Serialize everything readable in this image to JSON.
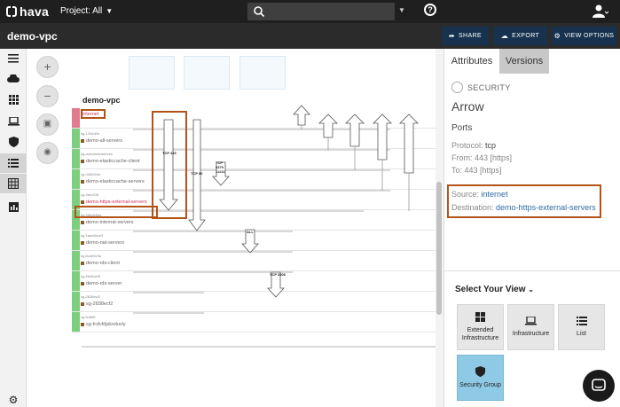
{
  "topbar": {
    "logo": "hava",
    "project": "Project: All"
  },
  "titlebar": {
    "env_name": "demo-vpc",
    "share": "SHARE",
    "export": "EXPORT",
    "view_options": "VIEW OPTIONS"
  },
  "diagram": {
    "vpc_name": "demo-vpc",
    "rows": [
      {
        "id": "",
        "name": "internet",
        "color": "red"
      },
      {
        "id": "sg-12d4d0e",
        "name": "demo-all-servers"
      },
      {
        "id": "sg-cbenab6cadecee",
        "name": "demo-elasticcache-client"
      },
      {
        "id": "sg-d3d5f2a4",
        "name": "demo-elasticcache-servers"
      },
      {
        "id": "sg-3fec208",
        "name": "demo-https-external-servers"
      },
      {
        "id": "sg-45bde6ba",
        "name": "demo-internal-servers"
      },
      {
        "id": "sg-1aea5ece3",
        "name": "demo-nat-servers"
      },
      {
        "id": "sg-8cde5c9a",
        "name": "demo-rds-client"
      },
      {
        "id": "sg-6bd6a1f0",
        "name": "demo-rds-server"
      },
      {
        "id": "sg-2838ecf2",
        "name": "sg-2838ecf2"
      },
      {
        "id": "sg-fcd6f8",
        "name": "sg-fcdcfdjskxduvly"
      }
    ],
    "rules": [
      {
        "label": "TCP 443"
      },
      {
        "label": "TCP 80"
      },
      {
        "label": "TCP 6379 11211"
      },
      {
        "label": "ALL"
      },
      {
        "label": "TCP 3306"
      }
    ]
  },
  "panel": {
    "tab_attributes": "Attributes",
    "tab_versions": "Versions",
    "type_label": "SECURITY",
    "title": "Arrow",
    "ports_heading": "Ports",
    "protocol_label": "Protocol:",
    "protocol_value": "tcp",
    "from_label": "From:",
    "from_value": "443 [https]",
    "to_label": "To:",
    "to_value": "443 [https]",
    "source_label": "Source:",
    "source_value": "internet",
    "destination_label": "Destination:",
    "destination_value": "demo-https-external-servers",
    "select_view": "Select Your View",
    "views": [
      {
        "label": "Extended Infrastructure",
        "icon": "extended-infrastructure-icon"
      },
      {
        "label": "Infrastructure",
        "icon": "laptop-icon"
      },
      {
        "label": "List",
        "icon": "list-icon"
      },
      {
        "label": "Security Group",
        "icon": "shield-icon",
        "selected": true
      }
    ]
  },
  "colors": {
    "highlight": "#b45317",
    "selected_view": "#8ec9e6",
    "button": "#16324f"
  }
}
